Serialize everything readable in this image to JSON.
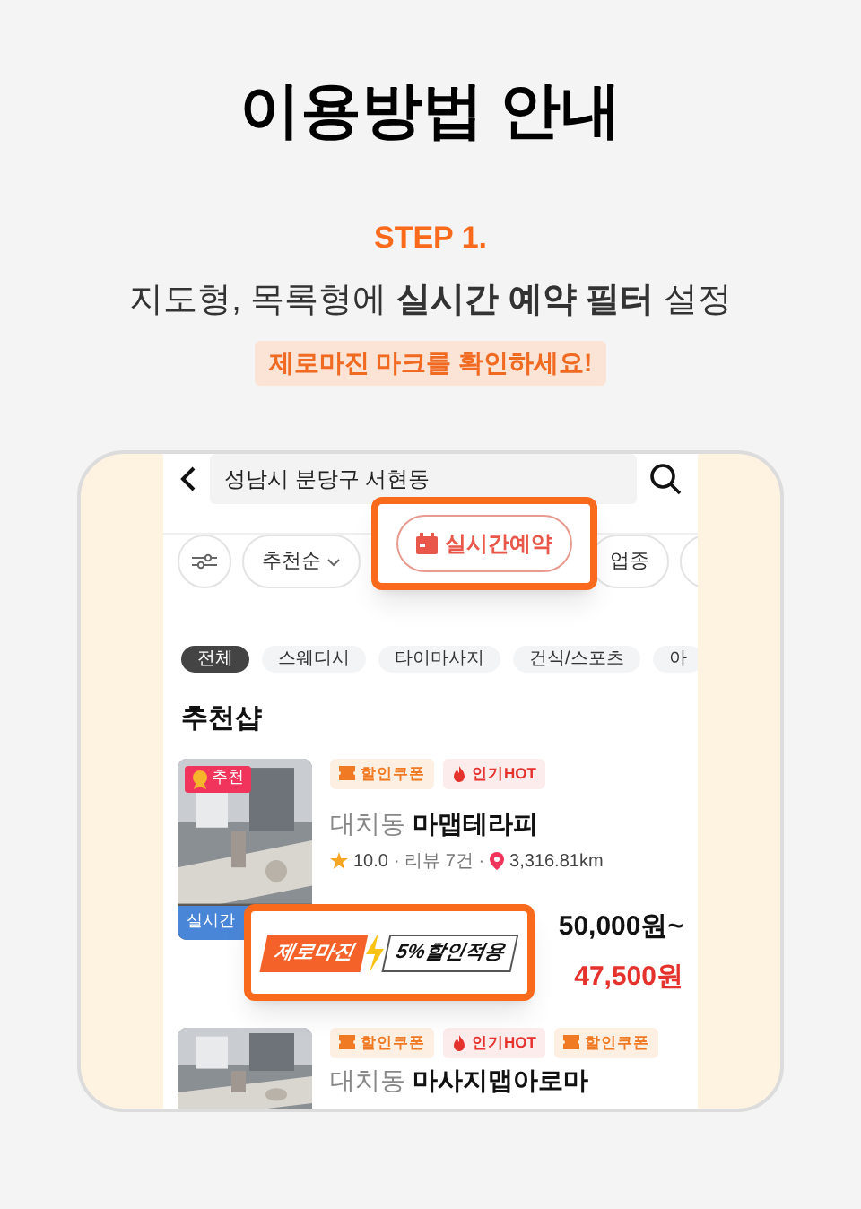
{
  "title": "이용방법 안내",
  "step": "STEP 1.",
  "subtitle": "지도형, 목록형에 **실시간 예약 필터** 설정",
  "note": "제로마진 마크를 확인하세요!",
  "search": {
    "value": "성남시 분당구 서현동"
  },
  "filters": [
    {
      "kind": "icon"
    },
    {
      "kind": "dropdown",
      "label": "추천순"
    },
    {
      "kind": "hidden"
    },
    {
      "kind": "chip",
      "label": "업종"
    },
    {
      "kind": "cut"
    }
  ],
  "realtime_popup": {
    "label": "실시간예약"
  },
  "categories": [
    {
      "label": "전체",
      "selected": true
    },
    {
      "label": "스웨디시",
      "selected": false
    },
    {
      "label": "타이마사지",
      "selected": false
    },
    {
      "label": "건식/스포츠",
      "selected": false
    },
    {
      "label": "아",
      "selected": false
    }
  ],
  "section": "추천샵",
  "shops": [
    {
      "badge": "추천",
      "photo_label": "실시간",
      "tags": [
        {
          "kind": "coupon",
          "label": "할인쿠폰"
        },
        {
          "kind": "hot",
          "label": "인기HOT"
        }
      ],
      "area": "대치동",
      "name": "마맵테라피",
      "rating": "10.0",
      "reviews": "· 리뷰 7건 ·",
      "distance": "3,316.81km",
      "price": "50,000원~",
      "sale_price": "47,500원"
    },
    {
      "tags": [
        {
          "kind": "coupon",
          "label": "할인쿠폰"
        },
        {
          "kind": "hot",
          "label": "인기HOT"
        },
        {
          "kind": "coupon",
          "label": "할인쿠폰"
        }
      ],
      "area": "대치동",
      "name": "마사지맵아로마"
    }
  ],
  "zero_popup": {
    "brand": "제로마진",
    "discount": "5%할인적용"
  }
}
